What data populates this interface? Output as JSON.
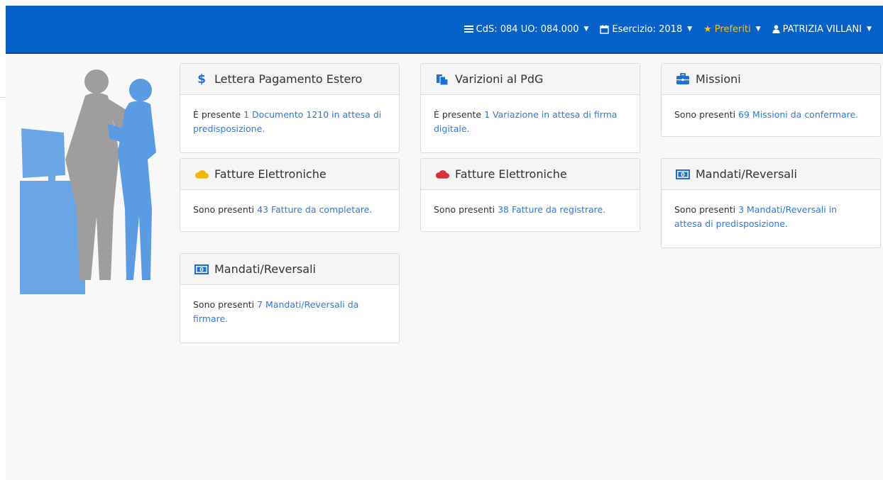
{
  "navbar": {
    "cds_label": "CdS: 084 UO: 084.000",
    "esercizio_label": "Esercizio: 2018",
    "preferiti_label": "Preferiti",
    "user_label": "PATRIZIA VILLANI"
  },
  "colors": {
    "navbar_bg": "#0560c8",
    "link": "#2a7ae2",
    "icon_blue": "#1e6fd9",
    "icon_yellow": "#f5b800",
    "icon_red": "#d9313a"
  },
  "cards": [
    {
      "title": "Lettera Pagamento Estero",
      "icon": "dollar-icon",
      "prefix": "È presente ",
      "link": "1 Documento 1210 in attesa di predisposizione."
    },
    {
      "title": "Varizioni al PdG",
      "icon": "copy-icon",
      "prefix": "È presente ",
      "link": "1 Variazione in attesa di firma digitale."
    },
    {
      "title": "Missioni",
      "icon": "briefcase-icon",
      "prefix": "Sono presenti ",
      "link": "69 Missioni da confermare."
    },
    {
      "title": "Fatture Elettroniche",
      "icon": "cloud-yellow-icon",
      "prefix": "Sono presenti ",
      "link": "43 Fatture da completare."
    },
    {
      "title": "Fatture Elettroniche",
      "icon": "cloud-red-icon",
      "prefix": "Sono presenti ",
      "link": "38 Fatture da registrare."
    },
    {
      "title": "Mandati/Reversali",
      "icon": "money-icon",
      "prefix": "Sono presenti ",
      "link": "3 Mandati/Reversali in attesa di predisposizione."
    },
    {
      "title": "Mandati/Reversali",
      "icon": "money-icon",
      "prefix": "Sono presenti ",
      "link": "7 Mandati/Reversali da firmare."
    }
  ]
}
